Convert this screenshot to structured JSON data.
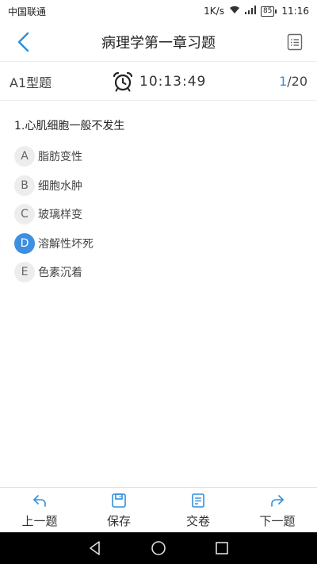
{
  "status_bar": {
    "carrier": "中国联通",
    "speed": "1K/s",
    "battery": "85",
    "time": "11:16"
  },
  "header": {
    "title": "病理学第一章习题",
    "back_icon": "chevron-left-icon",
    "menu_icon": "list-icon"
  },
  "info_bar": {
    "question_type": "A1型题",
    "timer": "10:13:49",
    "progress_current": "1",
    "progress_total": "/20"
  },
  "question": {
    "text": "1.心肌细胞一般不发生",
    "options": [
      {
        "letter": "A",
        "text": "脂肪变性"
      },
      {
        "letter": "B",
        "text": "细胞水肿"
      },
      {
        "letter": "C",
        "text": "玻璃样变"
      },
      {
        "letter": "D",
        "text": "溶解性坏死"
      },
      {
        "letter": "E",
        "text": "色素沉着"
      }
    ],
    "selected": "D"
  },
  "toolbar": {
    "prev_label": "上一题",
    "save_label": "保存",
    "submit_label": "交卷",
    "next_label": "下一题"
  },
  "colors": {
    "accent": "#3d8fe0",
    "option_bg": "#ededed"
  }
}
